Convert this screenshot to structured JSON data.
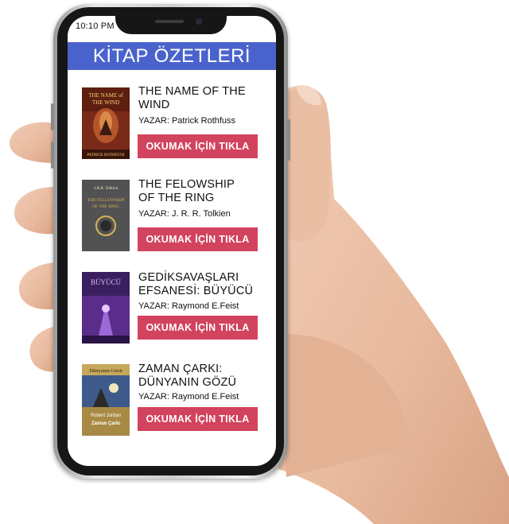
{
  "status_bar": {
    "time": "10:10 PM"
  },
  "header": {
    "title": "KİTAP ÖZETLERİ"
  },
  "books": [
    {
      "title_lines": [
        "THE NAME OF THE",
        "WIND"
      ],
      "author": "YAZAR: Patrick Rothfuss",
      "button": "OKUMAK İÇİN TIKLA",
      "cover_text": [
        "THE NAME of",
        "THE WIND",
        "PATRICK ROTHFUSS"
      ]
    },
    {
      "title_lines": [
        "THE FELOWSHIP",
        "OF THE RING"
      ],
      "author": "YAZAR: J. R. R. Tolkien",
      "button": "OKUMAK İÇİN TIKLA",
      "cover_text": [
        "J.R.R. Tolkien",
        "THE FELLOWSHIP",
        "OF THE RING"
      ]
    },
    {
      "title_lines": [
        "GEDİKSAVAŞLARI",
        "EFSANESİ: BÜYÜCÜ"
      ],
      "author": "YAZAR: Raymond E.Feist",
      "button": "OKUMAK İÇİN TIKLA",
      "cover_text": [
        "BÜYÜCÜ"
      ]
    },
    {
      "title_lines": [
        "ZAMAN ÇARKI:",
        "DÜNYANIN GÖZÜ"
      ],
      "author": "YAZAR: Raymond E.Feist",
      "button": "OKUMAK İÇİN TIKLA",
      "cover_text": [
        "Dünyanın Gözü",
        "Robert Jordan",
        "Zaman Çarkı"
      ]
    }
  ],
  "colors": {
    "header": "#4a63cc",
    "button": "#d2435d"
  }
}
